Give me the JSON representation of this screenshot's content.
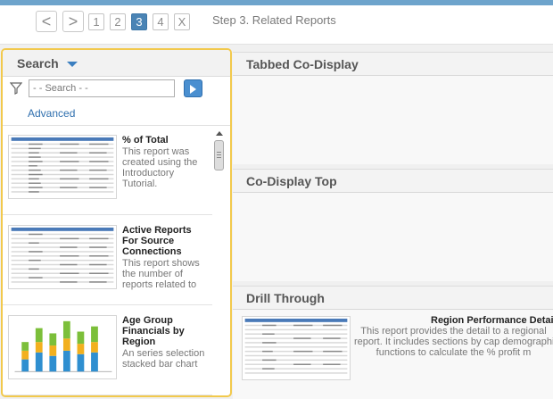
{
  "wizard": {
    "back_symbol": "<",
    "forward_symbol": ">",
    "steps": [
      "1",
      "2",
      "3",
      "4"
    ],
    "active_step": "3",
    "close_symbol": "X",
    "title": "Step 3. Related Reports"
  },
  "search": {
    "title": "Search",
    "placeholder": "- - Search - -",
    "advanced_label": "Advanced",
    "items": [
      {
        "title": "% of Total",
        "description": "This report was created using the Introductory Tutorial.",
        "thumbnail": "table-thumbnail"
      },
      {
        "title": "Active Reports For Source Connections",
        "description": "This report shows the number of reports related to",
        "thumbnail": "table-thumbnail"
      },
      {
        "title": "Age Group Financials by Region",
        "description": "An series selection stacked bar chart",
        "thumbnail": "stacked-bar-thumbnail"
      }
    ]
  },
  "panels": {
    "tabbed_title": "Tabbed Co-Display",
    "codisplay_top_title": "Co-Display Top",
    "drill_through_title": "Drill Through",
    "drill_report": {
      "title": "Region Performance Detail",
      "description": "This report provides the detail to a regional report. It includes sections by cap demographic functions to calculate the % profit m",
      "description_lines": [
        "This report provides the detail to a regional",
        "report. It includes sections by cap demographi",
        "functions to calculate the % profit m"
      ]
    }
  },
  "colors": {
    "accent": "#4a84b5",
    "panel_highlight": "#f2c94c",
    "link": "#2f6fae"
  }
}
